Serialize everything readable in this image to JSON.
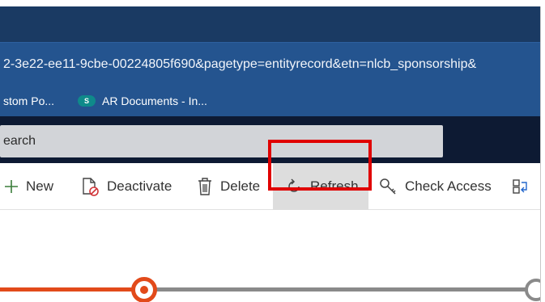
{
  "browser": {
    "address": "2-3e22-ee11-9cbe-00224805f690&pagetype=entityrecord&etn=nlcb_sponsorship&",
    "bookmarks": [
      {
        "label": "stom Po..."
      },
      {
        "label": "AR Documents - In...",
        "icon_text": "S"
      }
    ]
  },
  "app": {
    "search_placeholder": "earch"
  },
  "command_bar": {
    "new_label": "New",
    "deactivate_label": "Deactivate",
    "delete_label": "Delete",
    "refresh_label": "Refresh",
    "check_access_label": "Check Access"
  },
  "colors": {
    "browser_chrome": "#24548f",
    "app_header": "#0d1a33",
    "highlight": "#e00000",
    "stage_active": "#e24a1a",
    "stage_inactive": "#8a8a8a"
  }
}
